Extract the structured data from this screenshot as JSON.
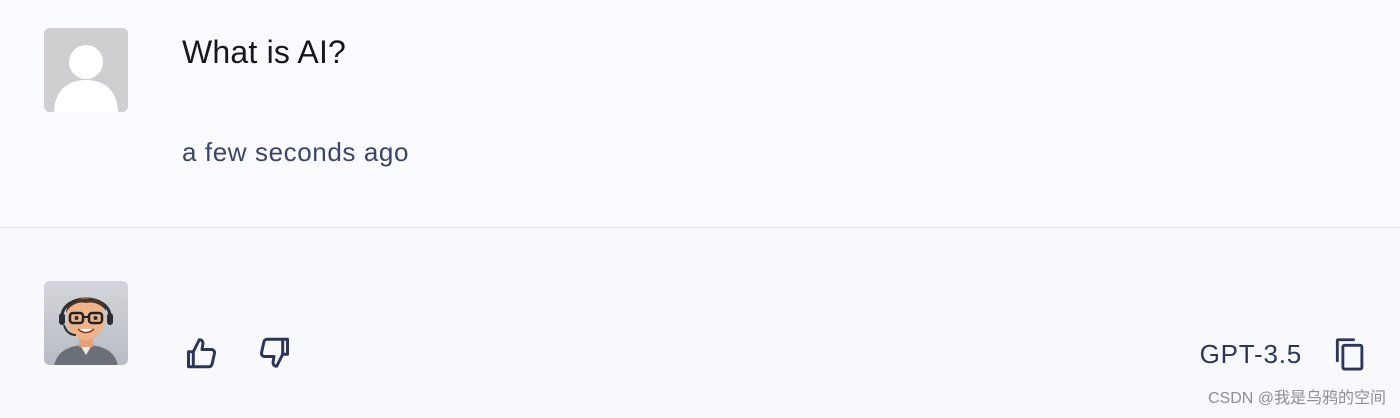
{
  "user_message": {
    "avatar_icon": "user-placeholder-icon",
    "text": "What is AI?",
    "timestamp": "a few seconds ago"
  },
  "bot_message": {
    "avatar_icon": "bot-avatar-icon",
    "actions": {
      "like_icon": "thumbs-up-icon",
      "dislike_icon": "thumbs-down-icon",
      "copy_icon": "copy-icon"
    },
    "model": "GPT-3.5"
  },
  "watermark": "CSDN @我是乌鸦的空间",
  "colors": {
    "background": "#f8f9fc",
    "divider": "#e6e8ef",
    "text_primary": "#16181f",
    "text_secondary": "#3d4469",
    "icon": "#2d3559"
  }
}
